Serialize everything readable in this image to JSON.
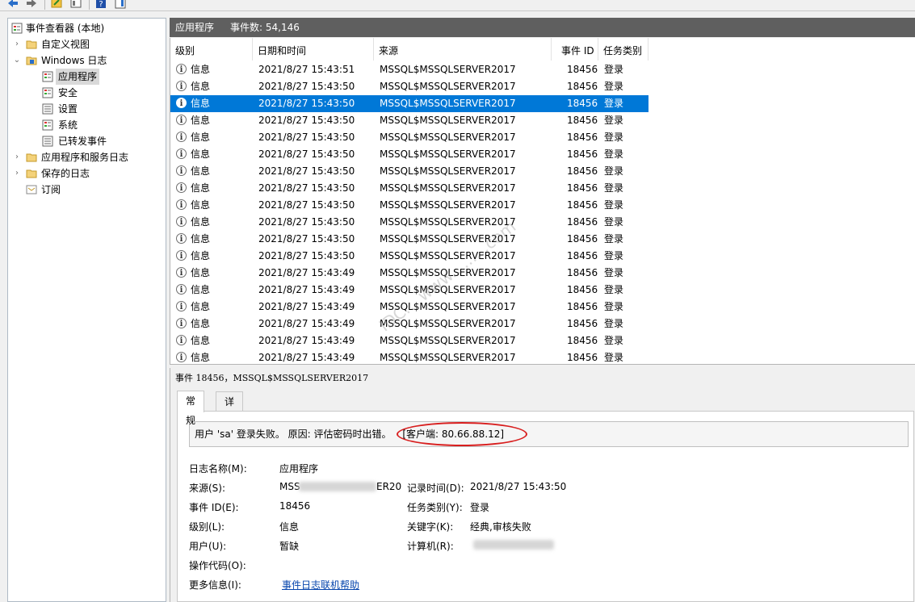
{
  "toolbar": {
    "icons": [
      "back-icon",
      "forward-icon",
      "up-folder-icon",
      "properties-icon",
      "help-icon",
      "show-pane-icon"
    ]
  },
  "tree": {
    "root": "事件查看器 (本地)",
    "custom_views": "自定义视图",
    "windows_logs": "Windows 日志",
    "application": "应用程序",
    "security": "安全",
    "setup": "设置",
    "system": "系统",
    "forwarded": "已转发事件",
    "app_service_logs": "应用程序和服务日志",
    "saved_logs": "保存的日志",
    "subscriptions": "订阅"
  },
  "header": {
    "title": "应用程序",
    "count": "事件数: 54,146"
  },
  "columns": {
    "level": "级别",
    "datetime": "日期和时间",
    "source": "来源",
    "event_id": "事件 ID",
    "category": "任务类别"
  },
  "rows": [
    {
      "level": "信息",
      "datetime": "2021/8/27 15:43:51",
      "source": "MSSQL$MSSQLSERVER2017",
      "event_id": "18456",
      "category": "登录"
    },
    {
      "level": "信息",
      "datetime": "2021/8/27 15:43:50",
      "source": "MSSQL$MSSQLSERVER2017",
      "event_id": "18456",
      "category": "登录"
    },
    {
      "level": "信息",
      "datetime": "2021/8/27 15:43:50",
      "source": "MSSQL$MSSQLSERVER2017",
      "event_id": "18456",
      "category": "登录"
    },
    {
      "level": "信息",
      "datetime": "2021/8/27 15:43:50",
      "source": "MSSQL$MSSQLSERVER2017",
      "event_id": "18456",
      "category": "登录"
    },
    {
      "level": "信息",
      "datetime": "2021/8/27 15:43:50",
      "source": "MSSQL$MSSQLSERVER2017",
      "event_id": "18456",
      "category": "登录"
    },
    {
      "level": "信息",
      "datetime": "2021/8/27 15:43:50",
      "source": "MSSQL$MSSQLSERVER2017",
      "event_id": "18456",
      "category": "登录"
    },
    {
      "level": "信息",
      "datetime": "2021/8/27 15:43:50",
      "source": "MSSQL$MSSQLSERVER2017",
      "event_id": "18456",
      "category": "登录"
    },
    {
      "level": "信息",
      "datetime": "2021/8/27 15:43:50",
      "source": "MSSQL$MSSQLSERVER2017",
      "event_id": "18456",
      "category": "登录"
    },
    {
      "level": "信息",
      "datetime": "2021/8/27 15:43:50",
      "source": "MSSQL$MSSQLSERVER2017",
      "event_id": "18456",
      "category": "登录"
    },
    {
      "level": "信息",
      "datetime": "2021/8/27 15:43:50",
      "source": "MSSQL$MSSQLSERVER2017",
      "event_id": "18456",
      "category": "登录"
    },
    {
      "level": "信息",
      "datetime": "2021/8/27 15:43:50",
      "source": "MSSQL$MSSQLSERVER2017",
      "event_id": "18456",
      "category": "登录"
    },
    {
      "level": "信息",
      "datetime": "2021/8/27 15:43:50",
      "source": "MSSQL$MSSQLSERVER2017",
      "event_id": "18456",
      "category": "登录"
    },
    {
      "level": "信息",
      "datetime": "2021/8/27 15:43:49",
      "source": "MSSQL$MSSQLSERVER2017",
      "event_id": "18456",
      "category": "登录"
    },
    {
      "level": "信息",
      "datetime": "2021/8/27 15:43:49",
      "source": "MSSQL$MSSQLSERVER2017",
      "event_id": "18456",
      "category": "登录"
    },
    {
      "level": "信息",
      "datetime": "2021/8/27 15:43:49",
      "source": "MSSQL$MSSQLSERVER2017",
      "event_id": "18456",
      "category": "登录"
    },
    {
      "level": "信息",
      "datetime": "2021/8/27 15:43:49",
      "source": "MSSQL$MSSQLSERVER2017",
      "event_id": "18456",
      "category": "登录"
    },
    {
      "level": "信息",
      "datetime": "2021/8/27 15:43:49",
      "source": "MSSQL$MSSQLSERVER2017",
      "event_id": "18456",
      "category": "登录"
    },
    {
      "level": "信息",
      "datetime": "2021/8/27 15:43:49",
      "source": "MSSQL$MSSQLSERVER2017",
      "event_id": "18456",
      "category": "登录"
    }
  ],
  "selected_row": 2,
  "detail": {
    "title": "事件 18456，MSSQL$MSSQLSERVER2017",
    "tab_general": "常规",
    "tab_details": "详细信息",
    "message": "用户 'sa' 登录失败。 原因: 评估密码时出错。",
    "client": "[客户端: 80.66.88.12]",
    "log_name_label": "日志名称(M):",
    "log_name": "应用程序",
    "source_label": "来源(S):",
    "source_visible_start": "MSS",
    "source_visible_end": "ER20",
    "logged_label": "记录时间(D):",
    "logged": "2021/8/27 15:43:50",
    "event_id_label": "事件 ID(E):",
    "event_id": "18456",
    "category_label": "任务类别(Y):",
    "category": "登录",
    "level_label": "级别(L):",
    "level": "信息",
    "keywords_label": "关键字(K):",
    "keywords": "经典,审核失败",
    "user_label": "用户(U):",
    "user": "暂缺",
    "computer_label": "计算机(R):",
    "opcode_label": "操作代码(O):",
    "more_info_label": "更多信息(I):",
    "more_info_link": "事件日志联机帮助"
  },
  "watermark": "IDC... www.........com",
  "colors": {
    "selection": "#0078d7",
    "header_bar": "#5f5f5f",
    "highlight_ellipse": "#d81e1e",
    "link": "#0645ad"
  }
}
